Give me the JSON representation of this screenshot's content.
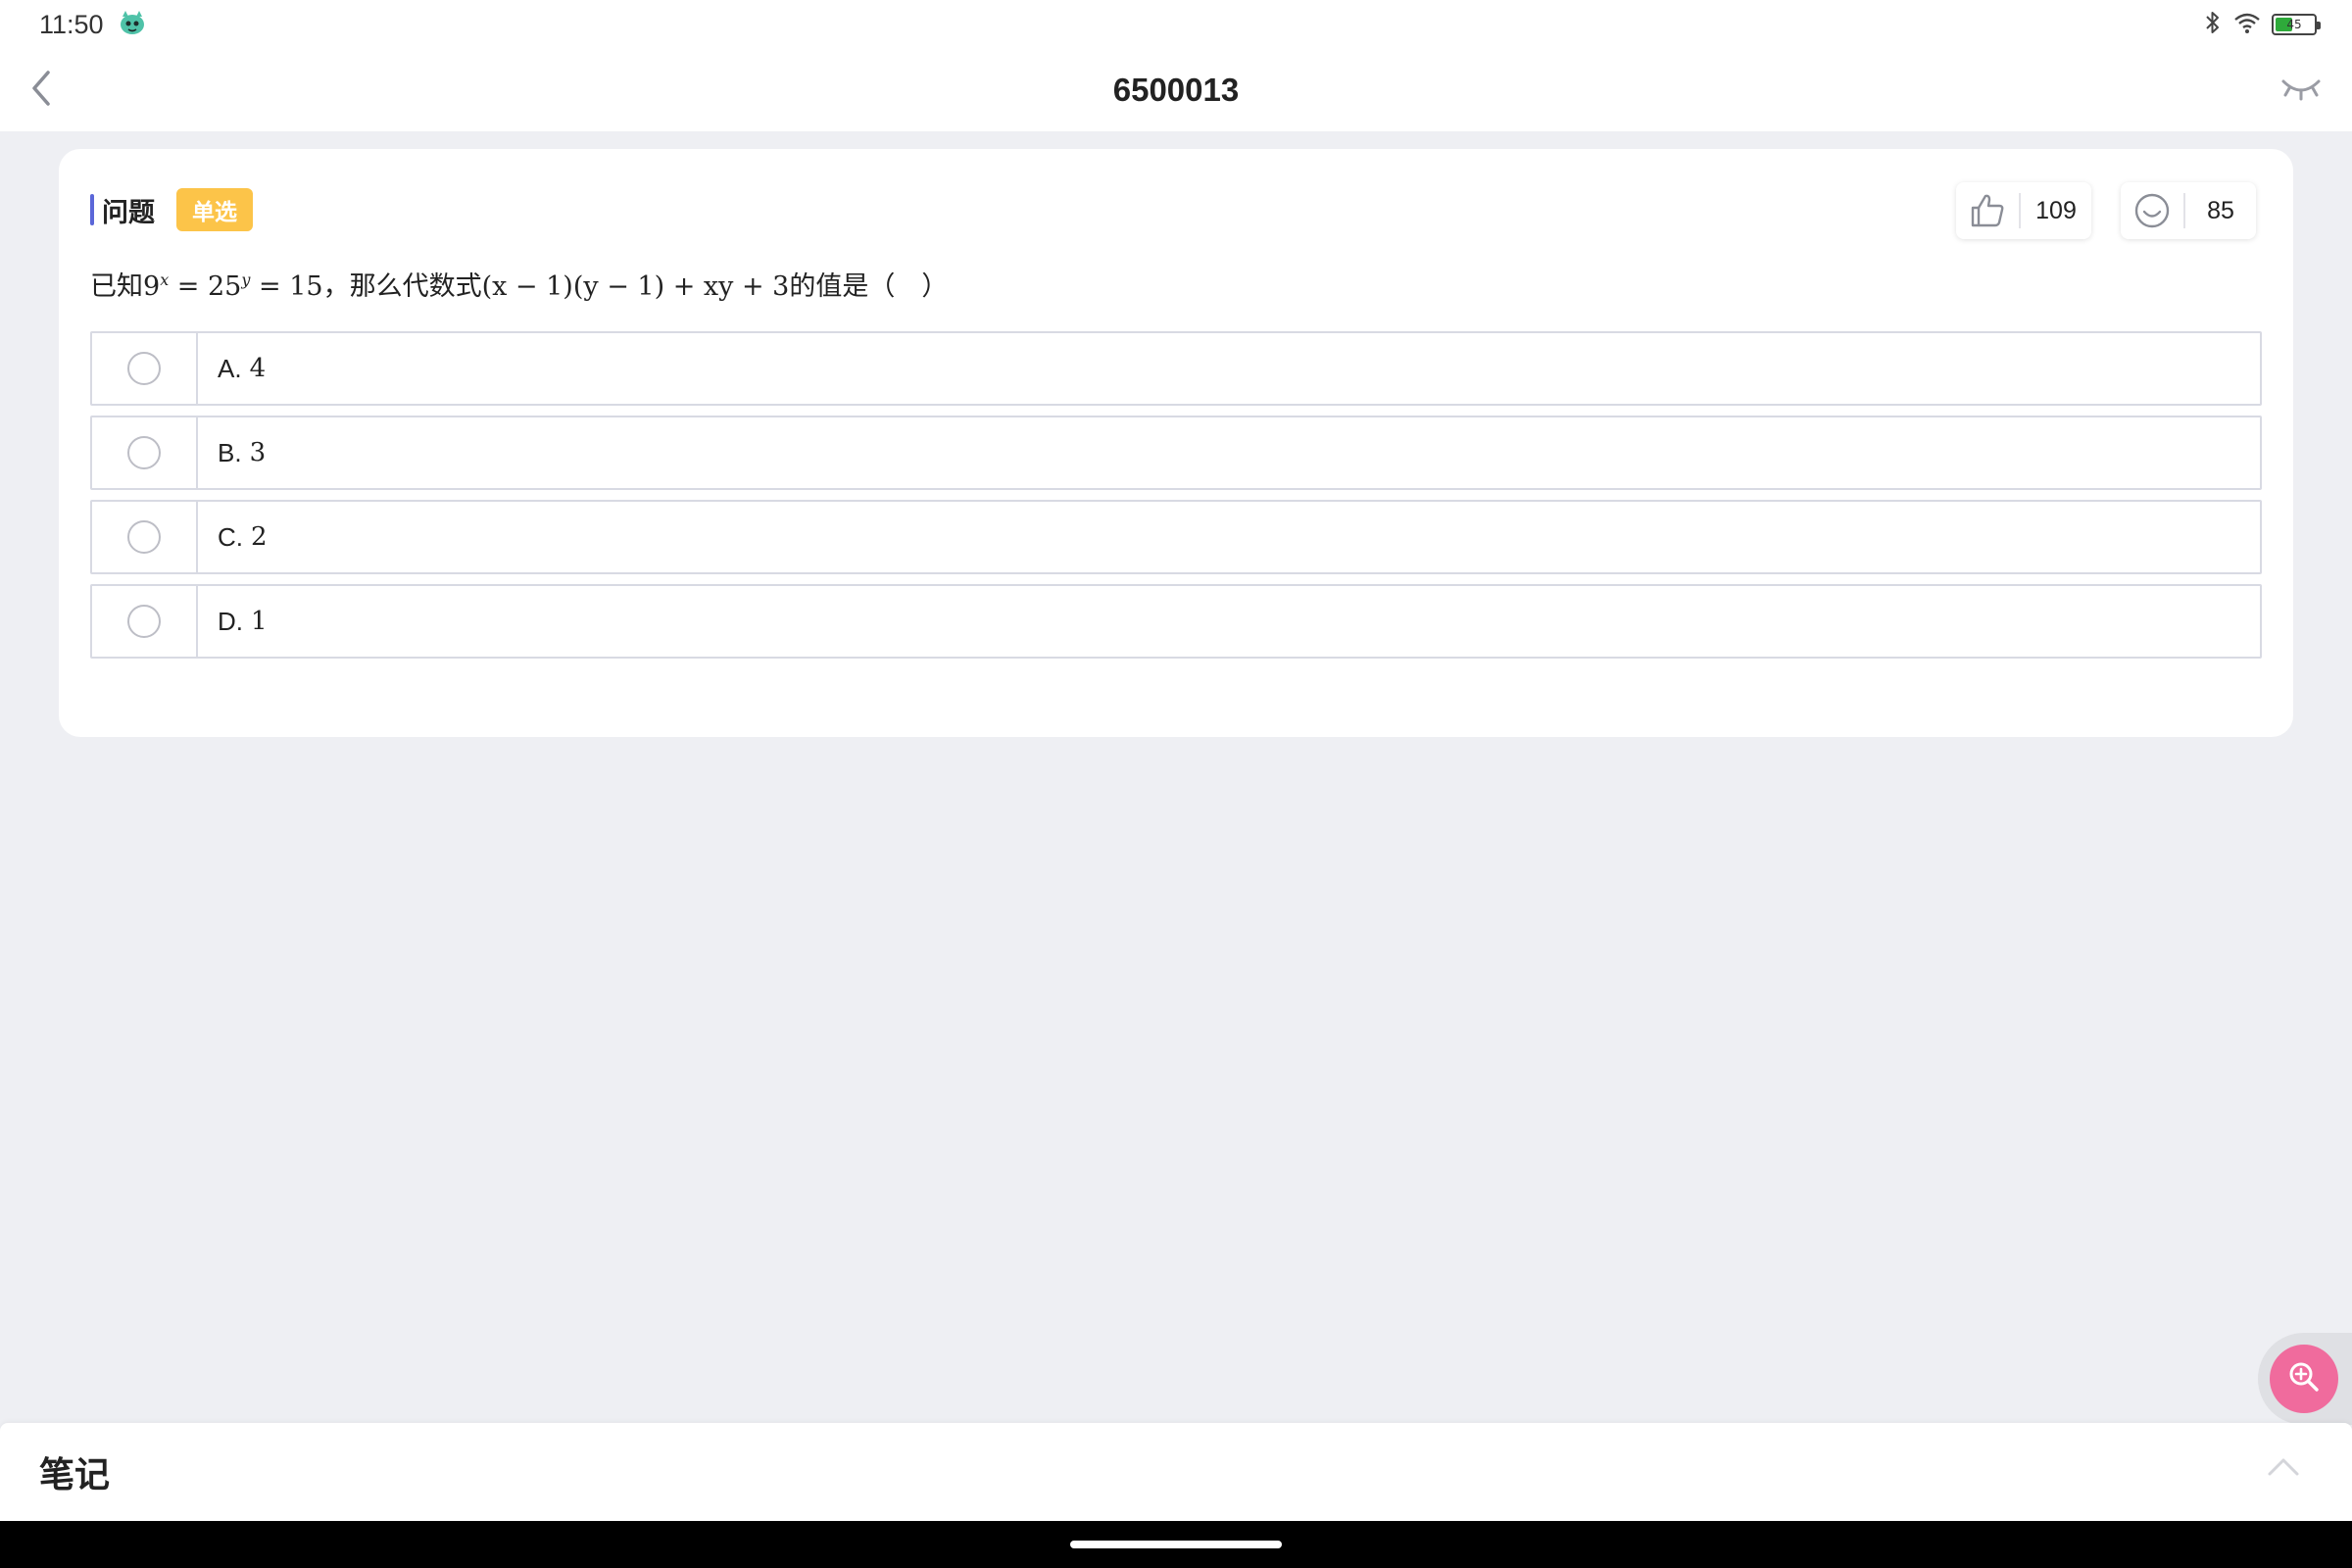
{
  "status_bar": {
    "time": "11:50",
    "battery_level": "45",
    "battery_fill_fraction": 0.45,
    "battery_color": "#2eaa3a"
  },
  "nav": {
    "title": "6500013",
    "back_icon": "chevron-left-icon",
    "eye_icon": "eye-closed-icon"
  },
  "question": {
    "section_label": "问题",
    "type_tag": "单选",
    "tag_color": "#fcc449",
    "accent_color": "#5b67d8",
    "likes": "109",
    "emoji_count": "85",
    "stem_prefix": "已知",
    "stem_math_1": "9",
    "stem_sup_1": "x",
    "stem_math_2": " = 25",
    "stem_sup_2": "y",
    "stem_math_3": " = 15",
    "stem_mid": "，那么代数式",
    "stem_math_4": "(x − 1)(y − 1) + xy + 3",
    "stem_suffix": "的值是（　）",
    "options": [
      {
        "letter": "A.",
        "value": "4"
      },
      {
        "letter": "B.",
        "value": "3"
      },
      {
        "letter": "C.",
        "value": "2"
      },
      {
        "letter": "D.",
        "value": "1"
      }
    ]
  },
  "zoom_fab": {
    "icon": "zoom-in-icon",
    "color": "#f06b9d"
  },
  "notes": {
    "title": "笔记",
    "chevron_icon": "chevron-up-icon"
  }
}
